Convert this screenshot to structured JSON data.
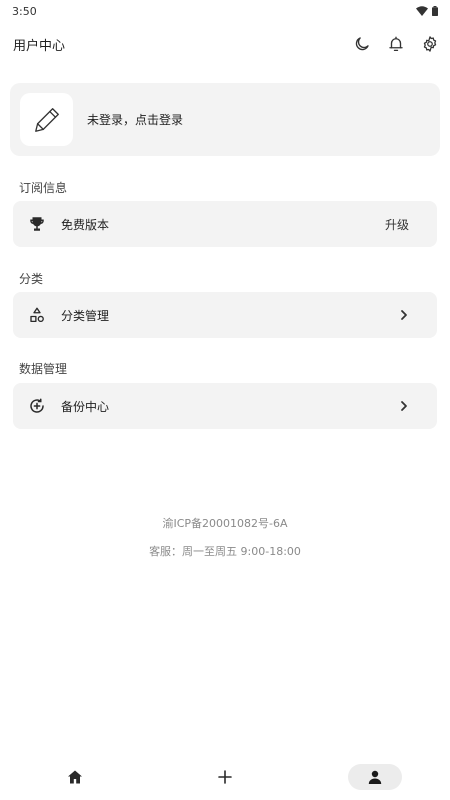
{
  "status_bar": {
    "time": "3:50"
  },
  "header": {
    "title": "用户中心"
  },
  "login": {
    "text": "未登录，点击登录"
  },
  "subscription": {
    "section_title": "订阅信息",
    "label": "免费版本",
    "action": "升级"
  },
  "category": {
    "section_title": "分类",
    "label": "分类管理"
  },
  "data_management": {
    "section_title": "数据管理",
    "label": "备份中心"
  },
  "footer": {
    "icp": "渝ICP备20001082号-6A",
    "service": "客服：周一至周五 9:00-18:00"
  },
  "icons": {
    "header": [
      "moon-icon",
      "bell-icon",
      "gear-icon"
    ],
    "nav": [
      "home-icon",
      "plus-icon",
      "user-icon"
    ]
  },
  "colors": {
    "card_bg": "#f3f3f3",
    "nav_active_bg": "#ececec",
    "footer_text": "#8a8a8a"
  }
}
